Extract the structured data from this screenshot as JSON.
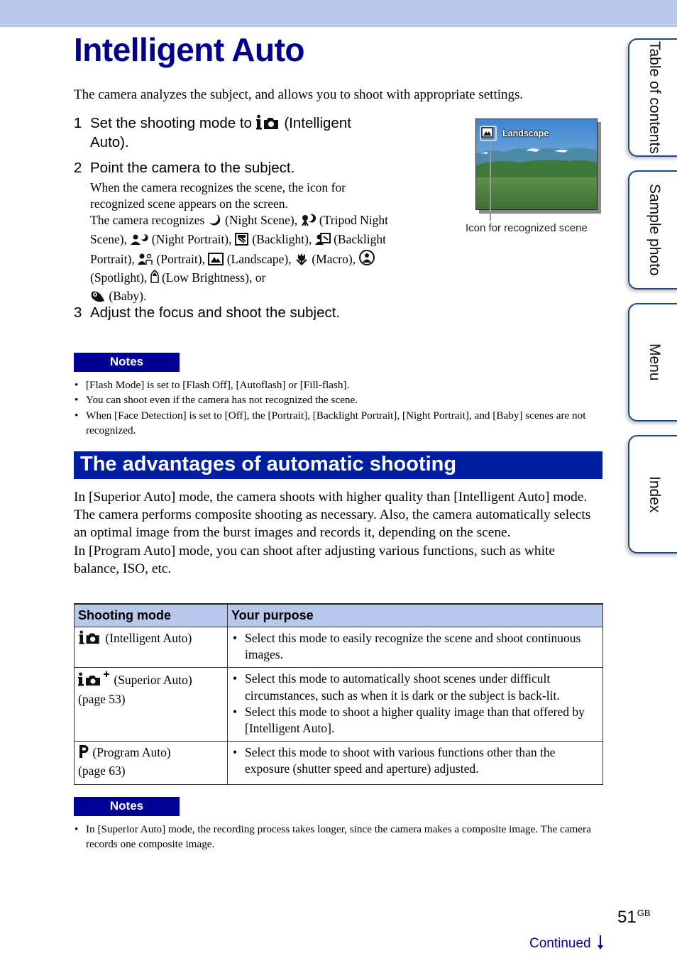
{
  "page": {
    "title": "Intelligent Auto",
    "intro": "The camera analyzes the subject, and allows you to shoot with appropriate settings."
  },
  "steps": [
    {
      "number": "1",
      "text_before": "Set the shooting mode to",
      "icon": "intelligent-auto-icon",
      "text_after": "(Intelligent",
      "text_line2": "Auto)."
    },
    {
      "number": "2",
      "text": "Point the camera to the subject."
    },
    {
      "number": "3",
      "text": "Adjust the focus and shoot the subject."
    }
  ],
  "step2_detail": {
    "line1": "When the camera recognizes the scene, the icon for recognized scene appears on the screen.",
    "recognizes_prefix": "The camera recognizes",
    "scenes": [
      {
        "icon": "night-scene-icon",
        "label": "(Night Scene),"
      },
      {
        "icon": "tripod-night-scene-icon",
        "label": "(Tripod Night Scene),"
      },
      {
        "icon": "night-portrait-icon",
        "label": "(Night Portrait),"
      },
      {
        "icon": "backlight-icon",
        "label": "(Backlight),"
      },
      {
        "icon": "backlight-portrait-icon",
        "label": "(Backlight Portrait),"
      },
      {
        "icon": "portrait-icon",
        "label": "(Portrait),"
      },
      {
        "icon": "landscape-icon",
        "label": "(Landscape),"
      },
      {
        "icon": "macro-icon",
        "label": "(Macro),"
      },
      {
        "icon": "spotlight-icon",
        "label": "(Spotlight),"
      },
      {
        "icon": "low-brightness-icon",
        "label": "(Low Brightness), or"
      },
      {
        "icon": "baby-icon",
        "label": "(Baby)."
      }
    ]
  },
  "illustration": {
    "screen_label": "Landscape",
    "callout": "Icon for recognized scene"
  },
  "notes_label": "Notes",
  "notes1": [
    "[Flash Mode] is set to [Flash Off], [Autoflash] or [Fill-flash].",
    "You can shoot even if the camera has not recognized the scene.",
    "When [Face Detection] is set to [Off], the [Portrait], [Backlight Portrait], [Night Portrait], and [Baby] scenes are not recognized."
  ],
  "section": {
    "heading": "The advantages of automatic shooting",
    "paragraph1": "In [Superior Auto] mode, the camera shoots with higher quality than [Intelligent Auto] mode. The camera performs composite shooting as necessary. Also, the camera automatically selects an optimal image from the burst images and records it, depending on the scene.",
    "paragraph2": "In [Program Auto] mode, you can shoot after adjusting various functions, such as white balance, ISO, etc."
  },
  "table": {
    "headers": [
      "Shooting mode",
      "Your purpose"
    ],
    "rows": [
      {
        "icon": "intelligent-auto-icon",
        "mode": "(Intelligent Auto)",
        "page": "",
        "purposes": [
          "Select this mode to easily recognize the scene and shoot continuous images."
        ]
      },
      {
        "icon": "superior-auto-icon",
        "mode": "(Superior Auto)",
        "page": "(page 53)",
        "purposes": [
          "Select this mode to automatically shoot scenes under difficult circumstances, such as when it is dark or the subject is back-lit.",
          "Select this mode to shoot a higher quality image than that offered by [Intelligent Auto]."
        ]
      },
      {
        "icon": "program-auto-icon",
        "mode": "(Program Auto)",
        "page": "(page 63)",
        "purposes": [
          "Select this mode to shoot with various functions other than the exposure (shutter speed and aperture) adjusted."
        ]
      }
    ]
  },
  "notes2": [
    "In [Superior Auto] mode, the recording process takes longer, since the camera makes a composite image. The camera records one composite image."
  ],
  "side_tabs": [
    {
      "label": "Table of contents"
    },
    {
      "label": "Sample photo"
    },
    {
      "label": "Menu"
    },
    {
      "label": "Index"
    }
  ],
  "footer": {
    "page_number": "51",
    "page_suffix": "GB",
    "continued": "Continued"
  },
  "colors": {
    "title": "#00008e",
    "header_band": "#b8c8ea",
    "notes_badge": "#000094",
    "section_bar": "#001ea0",
    "link": "#0000a0",
    "tab_border": "#1e4a8a"
  }
}
